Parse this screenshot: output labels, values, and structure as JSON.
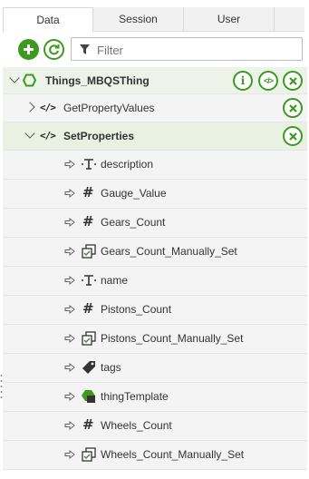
{
  "tabs": [
    {
      "label": "Data",
      "active": true
    },
    {
      "label": "Session",
      "active": false
    },
    {
      "label": "User",
      "active": false
    }
  ],
  "toolbar": {
    "add_icon": "plus-circle-icon",
    "refresh_icon": "refresh-circle-icon",
    "filter_placeholder": "Filter"
  },
  "tree": {
    "root": {
      "label": "Things_MBQSThing",
      "icon": "hexagon-icon",
      "expanded": true
    },
    "services": [
      {
        "label": "GetPropertyValues",
        "icon": "code-icon",
        "expanded": false
      },
      {
        "label": "SetProperties",
        "icon": "code-icon",
        "expanded": true
      }
    ],
    "parameters": [
      {
        "label": "description",
        "type": "text"
      },
      {
        "label": "Gauge_Value",
        "type": "number"
      },
      {
        "label": "Gears_Count",
        "type": "number"
      },
      {
        "label": "Gears_Count_Manually_Set",
        "type": "boolean"
      },
      {
        "label": "name",
        "type": "text"
      },
      {
        "label": "Pistons_Count",
        "type": "number"
      },
      {
        "label": "Pistons_Count_Manually_Set",
        "type": "boolean"
      },
      {
        "label": "tags",
        "type": "tags"
      },
      {
        "label": "thingTemplate",
        "type": "thingtemplate"
      },
      {
        "label": "Wheels_Count",
        "type": "number"
      },
      {
        "label": "Wheels_Count_Manually_Set",
        "type": "boolean"
      }
    ]
  },
  "colors": {
    "accent_green": "#3c9a1e",
    "selected_row": "#e8f1e2"
  }
}
